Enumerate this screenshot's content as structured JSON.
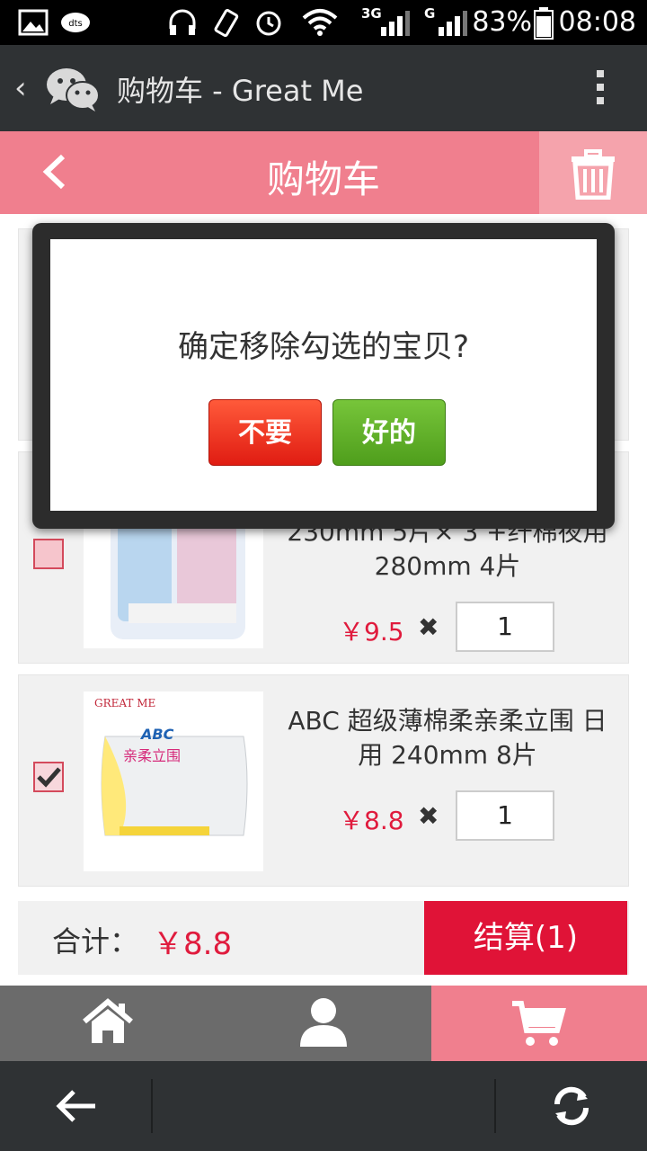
{
  "status_bar": {
    "battery_text": "83%",
    "time": "08:08",
    "network_labels": [
      "3G",
      "G"
    ]
  },
  "wechat_bar": {
    "title": "购物车 - Great Me"
  },
  "header": {
    "title": "购物车"
  },
  "items": [
    {
      "title_visible": "",
      "checked": false
    },
    {
      "title": "230mm 5片× 3 +纤棉夜用 280mm 4片",
      "price": "￥9.5",
      "times": "✖",
      "qty": "1",
      "checked": false
    },
    {
      "title": "ABC 超级薄棉柔亲柔立围 日用 240mm 8片",
      "price": "￥8.8",
      "times": "✖",
      "qty": "1",
      "checked": true,
      "thumb_label": "GREAT ME",
      "thumb_brand": "ABC",
      "thumb_product": "亲柔立围"
    }
  ],
  "total": {
    "label": "合计：",
    "value": "￥8.8",
    "checkout_label": "结算(1)"
  },
  "bottom_nav": [
    {
      "icon": "home-icon"
    },
    {
      "icon": "user-icon"
    },
    {
      "icon": "cart-icon"
    }
  ],
  "dialog": {
    "message": "确定移除勾选的宝贝?",
    "cancel_label": "不要",
    "confirm_label": "好的"
  },
  "colors": {
    "header_pink": "#f07f8e",
    "price_red": "#e01b3d",
    "checkout_red": "#e01337",
    "confirm_green": "#5aaa24",
    "cancel_red": "#e8301a"
  }
}
